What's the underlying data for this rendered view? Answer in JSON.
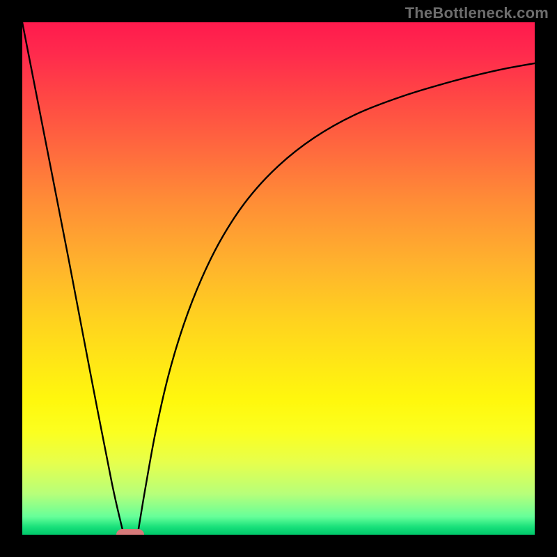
{
  "watermark": "TheBottleneck.com",
  "colors": {
    "frame": "#000000",
    "curve": "#000000",
    "marker": "#d77a7a"
  },
  "chart_data": {
    "type": "line",
    "title": "",
    "xlabel": "",
    "ylabel": "",
    "xlim": [
      0,
      100
    ],
    "ylim": [
      0,
      100
    ],
    "grid": false,
    "legend": false,
    "series": [
      {
        "name": "left-branch",
        "x": [
          0,
          4.5,
          9,
          13.2,
          17.5,
          19.8
        ],
        "y": [
          100,
          77,
          54,
          32,
          10,
          0
        ]
      },
      {
        "name": "right-branch",
        "x": [
          22.5,
          24,
          26,
          28.5,
          31.5,
          35,
          39,
          44,
          50,
          57,
          65,
          74,
          84,
          93,
          100
        ],
        "y": [
          0,
          9,
          20,
          31,
          41,
          50,
          58,
          65.5,
          72,
          77.5,
          82,
          85.5,
          88.5,
          90.7,
          92
        ]
      }
    ],
    "annotations": [
      {
        "name": "min-marker",
        "x": 21,
        "y": 0
      }
    ],
    "background_gradient": {
      "top": "#ff1a4d",
      "mid": "#ffe815",
      "bottom": "#00c86b"
    }
  }
}
